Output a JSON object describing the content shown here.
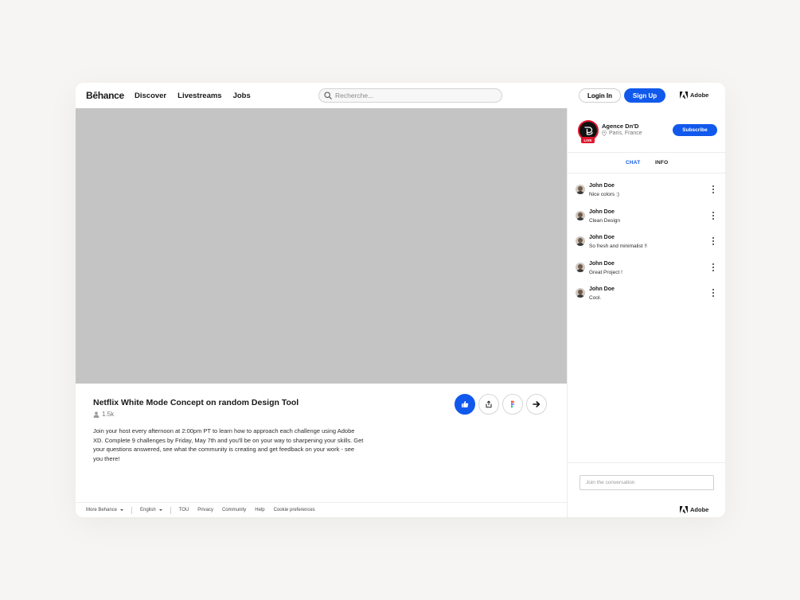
{
  "header": {
    "logo": "Bēhance",
    "nav": [
      "Discover",
      "Livestreams",
      "Jobs"
    ],
    "search_placeholder": "Recherche...",
    "login_label": "Login In",
    "signup_label": "Sign Up",
    "adobe_label": "Adobe"
  },
  "stream": {
    "title": "Netflix White Mode Concept on random Design Tool",
    "viewers": "1.5k",
    "description": "Join your host every afternoon at 2:00pm PT to learn how to approach each challenge using Adobe XD. Complete 9 challenges by Friday, May 7th and you'll be on your way to sharpening your skills. Get your questions answered, see what the community is creating and get feedback on your work - see you there!"
  },
  "channel": {
    "name": "Agence Dn'D",
    "location": "Paris, France",
    "live_badge": "LIVE",
    "subscribe_label": "Subscribe"
  },
  "tabs": {
    "chat": "CHAT",
    "info": "INFO"
  },
  "messages": [
    {
      "name": "John Doe",
      "text": "Nice colors :)"
    },
    {
      "name": "John Doe",
      "text": "Clean Design"
    },
    {
      "name": "John Doe",
      "text": "So fresh and minimalist !!"
    },
    {
      "name": "John Doe",
      "text": "Great Project !"
    },
    {
      "name": "John Doe",
      "text": "Cool."
    }
  ],
  "chat_placeholder": "Join the conversation",
  "footer": {
    "more": "More Behance",
    "language": "English",
    "links": [
      "TOU",
      "Privacy",
      "Community",
      "Help",
      "Cookie preferences"
    ],
    "adobe_label": "Adobe"
  },
  "colors": {
    "accent": "#1159ec",
    "live": "#e0152d",
    "video_placeholder": "#c4c4c4"
  }
}
